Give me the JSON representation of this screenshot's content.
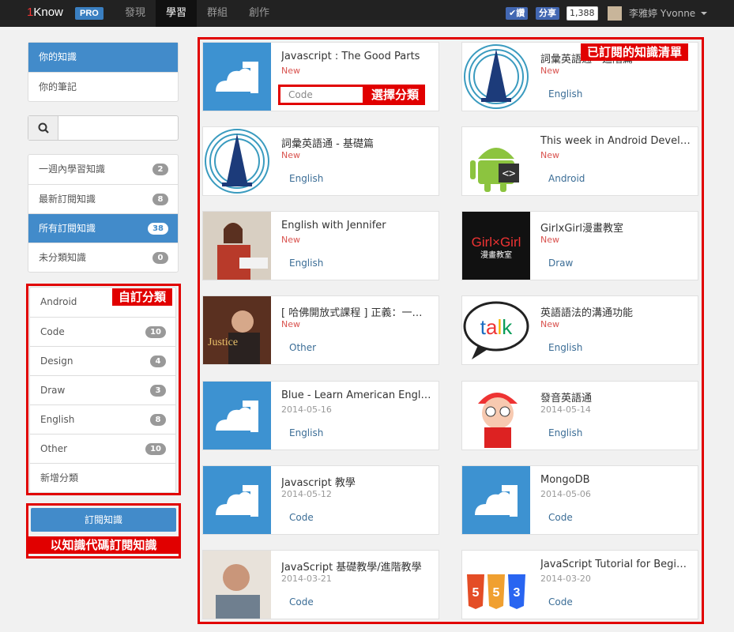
{
  "topbar": {
    "logo_one": "1",
    "logo_text": "Know",
    "pro": "PRO",
    "nav": [
      "發現",
      "學習",
      "群組",
      "創作"
    ],
    "fb_like": "✔讚",
    "fb_share": "分享",
    "fb_count": "1,388",
    "username": "李雅婷 Yvonne"
  },
  "sidebar": {
    "top": [
      "你的知識",
      "你的筆記"
    ],
    "filters": [
      {
        "label": "一週內學習知識",
        "count": "2"
      },
      {
        "label": "最新訂閱知識",
        "count": "8"
      },
      {
        "label": "所有訂閱知識",
        "count": "38"
      },
      {
        "label": "未分類知識",
        "count": "0"
      }
    ],
    "categories": [
      {
        "label": "Android",
        "count": ""
      },
      {
        "label": "Code",
        "count": "10"
      },
      {
        "label": "Design",
        "count": "4"
      },
      {
        "label": "Draw",
        "count": "3"
      },
      {
        "label": "English",
        "count": "8"
      },
      {
        "label": "Other",
        "count": "10"
      },
      {
        "label": "新增分類",
        "count": ""
      }
    ],
    "subscribe_button": "訂閱知識"
  },
  "annotations": {
    "custom_categories": "自訂分類",
    "subscribe_by_code": "以知識代碼訂閱知識",
    "subscribed_list": "已訂閱的知識清單",
    "choose_category": "選擇分類",
    "choose_value": "Code"
  },
  "cards": [
    {
      "title": "Javascript : The Good Parts",
      "status": "New",
      "date": "",
      "category": "Code",
      "thumb": "cloud"
    },
    {
      "title": "詞彙英語通 - 進階篇",
      "status": "New",
      "date": "",
      "category": "English",
      "thumb": "seal"
    },
    {
      "title": "詞彙英語通 - 基礎篇",
      "status": "New",
      "date": "",
      "category": "English",
      "thumb": "seal"
    },
    {
      "title": "This week in Android Development",
      "status": "New",
      "date": "",
      "category": "Android",
      "thumb": "android"
    },
    {
      "title": "English with Jennifer",
      "status": "New",
      "date": "",
      "category": "English",
      "thumb": "photo-w"
    },
    {
      "title": "GirlxGirl漫畫教室",
      "status": "New",
      "date": "",
      "category": "Draw",
      "thumb": "girl"
    },
    {
      "title": "[ 哈佛開放式課程 ] 正義：一場思辨之旅",
      "status": "New",
      "date": "",
      "category": "Other",
      "thumb": "justice"
    },
    {
      "title": "英語語法的溝通功能",
      "status": "New",
      "date": "",
      "category": "English",
      "thumb": "talk"
    },
    {
      "title": "Blue - Learn American English",
      "status": "",
      "date": "2014-05-16",
      "category": "English",
      "thumb": "cloud"
    },
    {
      "title": "發音英語通",
      "status": "",
      "date": "2014-05-14",
      "category": "English",
      "thumb": "cartoon"
    },
    {
      "title": "Javascript 教學",
      "status": "",
      "date": "2014-05-12",
      "category": "Code",
      "thumb": "cloud"
    },
    {
      "title": "MongoDB",
      "status": "",
      "date": "2014-05-06",
      "category": "Code",
      "thumb": "cloud"
    },
    {
      "title": "JavaScript 基礎教學/進階教學",
      "status": "",
      "date": "2014-03-21",
      "category": "Code",
      "thumb": "photo-m"
    },
    {
      "title": "JavaScript Tutorial for Beginners",
      "status": "",
      "date": "2014-03-20",
      "category": "Code",
      "thumb": "html5"
    }
  ],
  "colors": {
    "primary": "#428bca",
    "annotation_red": "#e10000",
    "new": "#d9534f"
  }
}
